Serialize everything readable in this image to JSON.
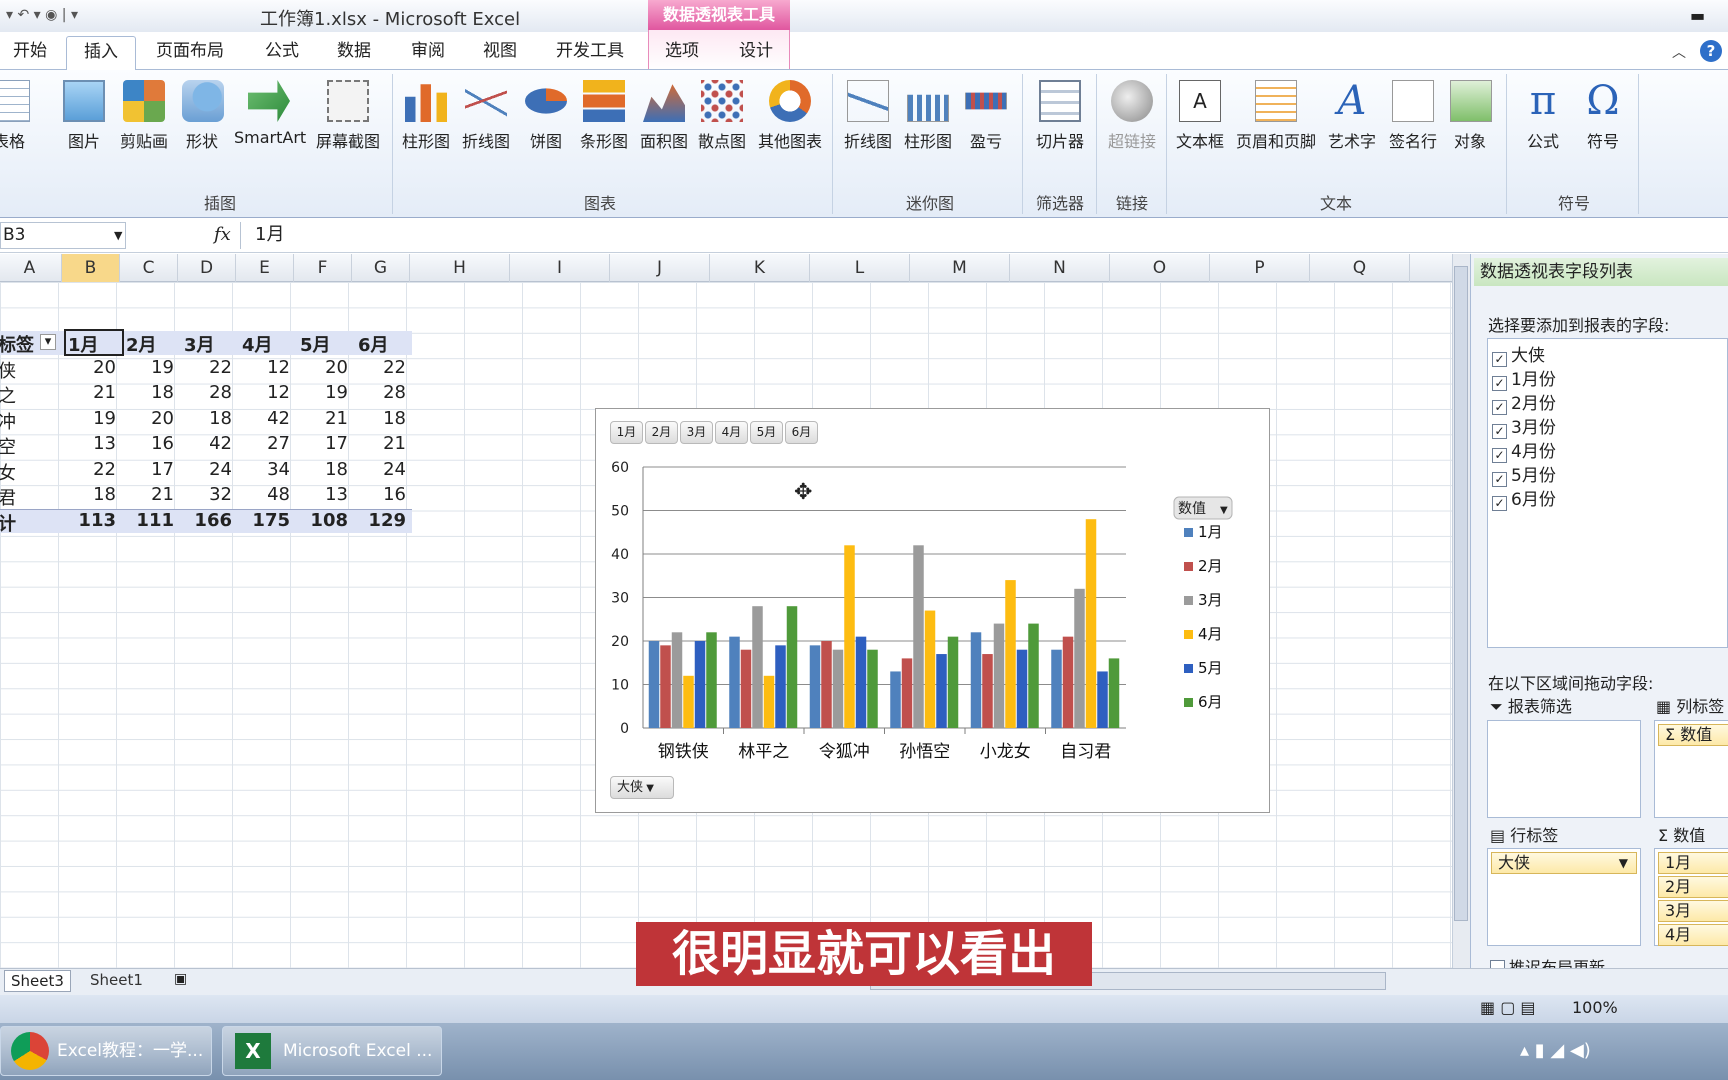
{
  "window": {
    "title": "工作簿1.xlsx - Microsoft Excel",
    "context_tab_group": "数据透视表工具"
  },
  "tabs": [
    {
      "label": "开始"
    },
    {
      "label": "插入"
    },
    {
      "label": "页面布局"
    },
    {
      "label": "公式"
    },
    {
      "label": "数据"
    },
    {
      "label": "审阅"
    },
    {
      "label": "视图"
    },
    {
      "label": "开发工具"
    },
    {
      "label": "选项"
    },
    {
      "label": "设计"
    }
  ],
  "ribbon": {
    "buttons": [
      "表格",
      "图片",
      "剪贴画",
      "形状",
      "SmartArt",
      "屏幕截图",
      "柱形图",
      "折线图",
      "饼图",
      "条形图",
      "面积图",
      "散点图",
      "其他图表",
      "折线图",
      "柱形图",
      "盈亏",
      "切片器",
      "超链接",
      "文本框",
      "页眉和页脚",
      "艺术字",
      "签名行",
      "对象",
      "公式",
      "符号"
    ],
    "groups": [
      "插图",
      "图表",
      "迷你图",
      "筛选器",
      "链接",
      "文本",
      "符号"
    ]
  },
  "formula_bar": {
    "name_box": "B3",
    "fx": "fx",
    "value": "1月"
  },
  "columns": [
    "A",
    "B",
    "C",
    "D",
    "E",
    "F",
    "G",
    "H",
    "I",
    "J",
    "K",
    "L",
    "M",
    "N",
    "O",
    "P",
    "Q"
  ],
  "pivot": {
    "header": {
      "label": "标签",
      "months": [
        "1月",
        "2月",
        "3月",
        "4月",
        "5月",
        "6月"
      ]
    },
    "rows": [
      {
        "label": "侠",
        "values": [
          "20",
          "19",
          "22",
          "12",
          "20",
          "22"
        ]
      },
      {
        "label": "之",
        "values": [
          "21",
          "18",
          "28",
          "12",
          "19",
          "28"
        ]
      },
      {
        "label": "冲",
        "values": [
          "19",
          "20",
          "18",
          "42",
          "21",
          "18"
        ]
      },
      {
        "label": "空",
        "values": [
          "13",
          "16",
          "42",
          "27",
          "17",
          "21"
        ]
      },
      {
        "label": "女",
        "values": [
          "22",
          "17",
          "24",
          "34",
          "18",
          "24"
        ]
      },
      {
        "label": "君",
        "values": [
          "18",
          "21",
          "32",
          "48",
          "13",
          "16"
        ]
      }
    ],
    "total": {
      "label": "计",
      "values": [
        "113",
        "111",
        "166",
        "175",
        "108",
        "129"
      ]
    }
  },
  "chart_data": {
    "type": "bar",
    "categories": [
      "钢铁侠",
      "林平之",
      "令狐冲",
      "孙悟空",
      "小龙女",
      "自习君"
    ],
    "series": [
      {
        "name": "1月",
        "values": [
          20,
          21,
          19,
          13,
          22,
          18
        ],
        "color": "#4f81bd"
      },
      {
        "name": "2月",
        "values": [
          19,
          18,
          20,
          16,
          17,
          21
        ],
        "color": "#c0504d"
      },
      {
        "name": "3月",
        "values": [
          22,
          28,
          18,
          42,
          24,
          32
        ],
        "color": "#9b9b9b"
      },
      {
        "name": "4月",
        "values": [
          12,
          12,
          42,
          27,
          34,
          48
        ],
        "color": "#fdbc11"
      },
      {
        "name": "5月",
        "values": [
          20,
          19,
          21,
          17,
          18,
          13
        ],
        "color": "#2e5fc0"
      },
      {
        "name": "6月",
        "values": [
          22,
          28,
          18,
          21,
          24,
          16
        ],
        "color": "#4f9a3a"
      }
    ],
    "ylim": [
      0,
      60
    ],
    "yticks": [
      0,
      10,
      20,
      30,
      40,
      50,
      60
    ],
    "grid": true,
    "legend": "right",
    "legend_title": "数值",
    "field_buttons": [
      "1月",
      "2月",
      "3月",
      "4月",
      "5月",
      "6月"
    ],
    "axis_field_button": "大侠"
  },
  "pane": {
    "title": "数据透视表字段列表",
    "choose_label": "选择要添加到报表的字段:",
    "fields": [
      "大侠",
      "1月份",
      "2月份",
      "3月份",
      "4月份",
      "5月份",
      "6月份"
    ],
    "drag_label": "在以下区域间拖动字段:",
    "filter_label": "报表筛选",
    "col_label": "列标签",
    "col_item": "数值",
    "row_label": "行标签",
    "row_item": "大侠",
    "values_label": "数值",
    "value_items": [
      "1月",
      "2月",
      "3月",
      "4月"
    ],
    "defer_label": "推迟布局更新"
  },
  "sheets": [
    "Sheet3",
    "Sheet1"
  ],
  "status": {
    "zoom": "100%"
  },
  "taskbar": {
    "items": [
      "Excel教程：一学...",
      "Microsoft Excel ..."
    ]
  },
  "subtitle": "很明显就可以看出"
}
